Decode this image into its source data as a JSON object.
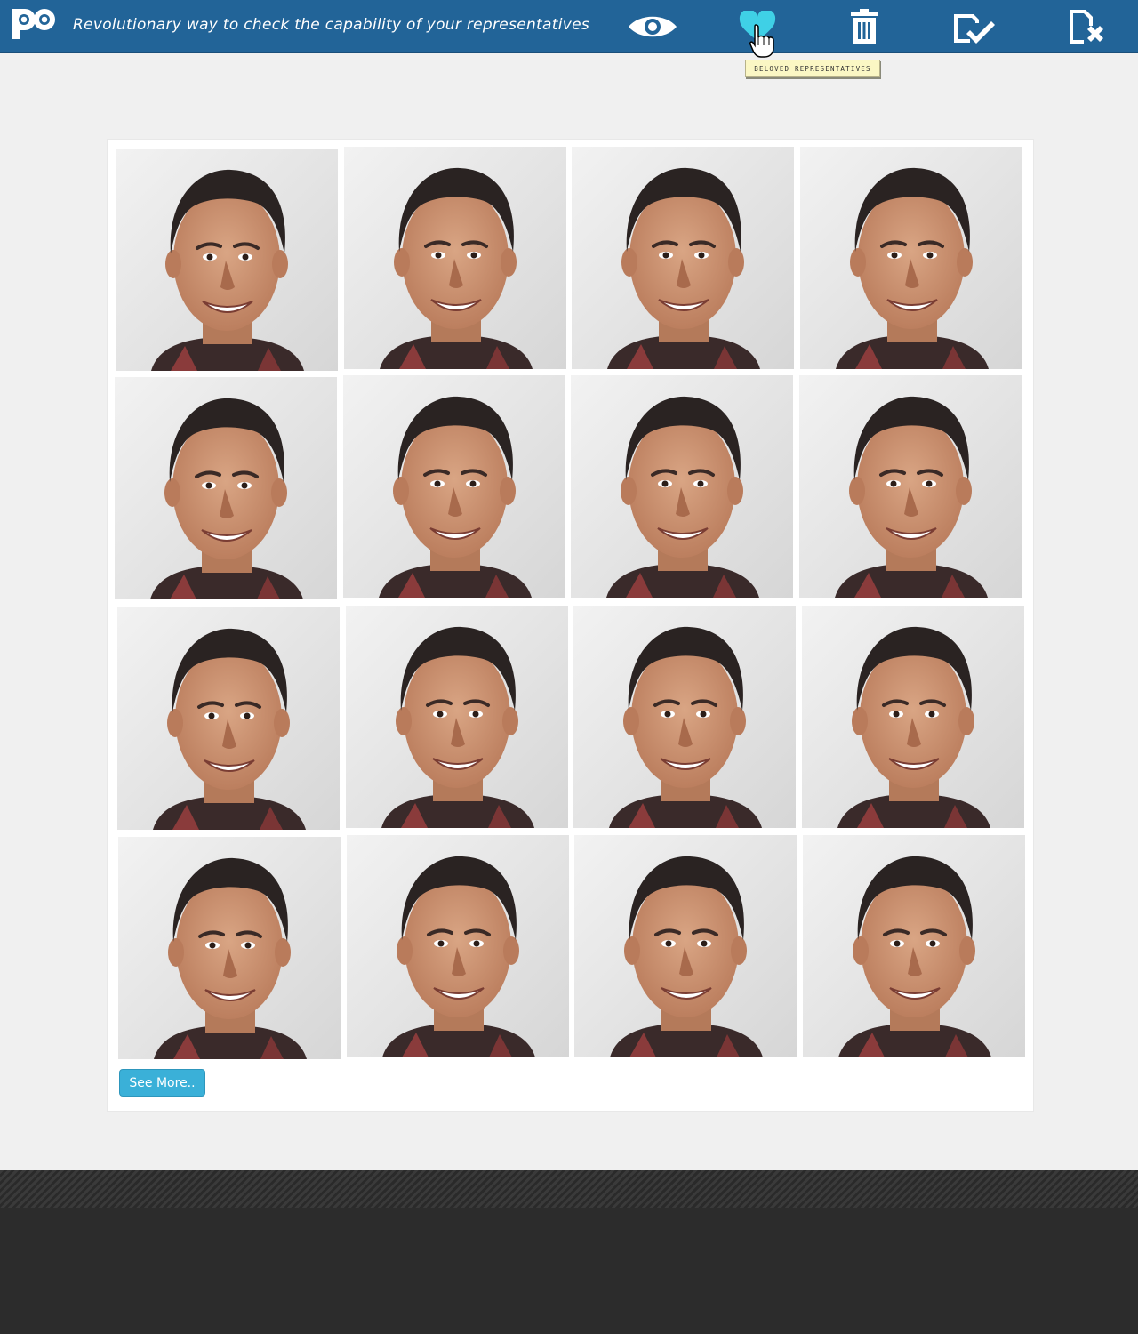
{
  "header": {
    "logo_text": "po",
    "tagline": "Revolutionary way to check the capability of your representatives",
    "nav": [
      {
        "icon": "eye-icon",
        "label": "view"
      },
      {
        "icon": "heart-icon",
        "label": "beloved"
      },
      {
        "icon": "trash-icon",
        "label": "delete"
      },
      {
        "icon": "document-check-icon",
        "label": "approve"
      },
      {
        "icon": "document-cross-icon",
        "label": "reject"
      }
    ],
    "tooltip": "BELOVED REPRESENTATIVES"
  },
  "gallery": {
    "photo_count": 16,
    "see_more_label": "See More.."
  },
  "colors": {
    "header_bg": "#226498",
    "accent_heart": "#3fd0e6",
    "button_bg": "#3ab0d8",
    "footer_bg": "#2c2c2c"
  }
}
